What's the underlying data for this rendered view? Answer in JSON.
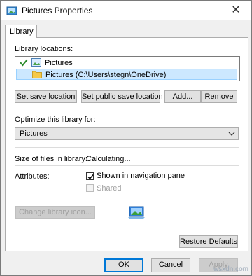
{
  "window": {
    "title": "Pictures Properties"
  },
  "tabs": [
    {
      "label": "Library"
    }
  ],
  "library_locations": {
    "label": "Library locations:",
    "items": [
      {
        "label": "Pictures",
        "checked": true
      },
      {
        "label": "Pictures (C:\\Users\\stegn\\OneDrive)",
        "selected": true
      }
    ]
  },
  "location_buttons": {
    "set_save": "Set save location",
    "set_public_save": "Set public save location",
    "add": "Add...",
    "remove": "Remove"
  },
  "optimize": {
    "label": "Optimize this library for:",
    "value": "Pictures"
  },
  "size": {
    "label": "Size of files in library:",
    "value": "Calculating..."
  },
  "attributes": {
    "label": "Attributes:",
    "shown_in_nav": {
      "label": "Shown in navigation pane",
      "checked": true
    },
    "shared": {
      "label": "Shared",
      "checked": false,
      "disabled": true
    }
  },
  "change_icon_button": "Change library icon...",
  "restore_defaults_button": "Restore Defaults",
  "dialog_buttons": {
    "ok": "OK",
    "cancel": "Cancel",
    "apply": "Apply"
  },
  "watermark": "wsxdn.com",
  "colors": {
    "selection_bg": "#cce8ff",
    "focus_border": "#0078d7"
  }
}
